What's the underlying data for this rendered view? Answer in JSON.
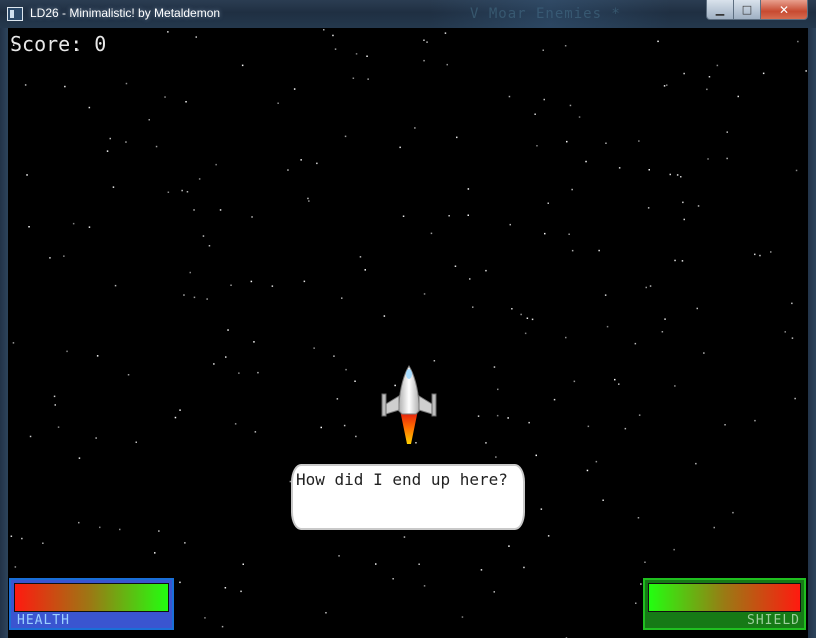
{
  "window": {
    "title": "LD26 - Minimalistic! by Metaldemon",
    "background_tab_text": "V Moar Enemies *",
    "buttons": {
      "minimize": "▁",
      "maximize": "□",
      "close": "✕"
    }
  },
  "hud": {
    "score_text": "Score: 0",
    "health_label": "HEALTH",
    "shield_label": "SHIELD",
    "health_level": 1.0,
    "shield_level": 1.0
  },
  "dialog": {
    "speech_text": "How did I end up here?"
  },
  "colors": {
    "space": "#000000",
    "health_frame": "#3a55d0",
    "shield_frame": "#167a16",
    "star": "#ffffff"
  },
  "icons": {
    "player": "spaceship-icon"
  }
}
